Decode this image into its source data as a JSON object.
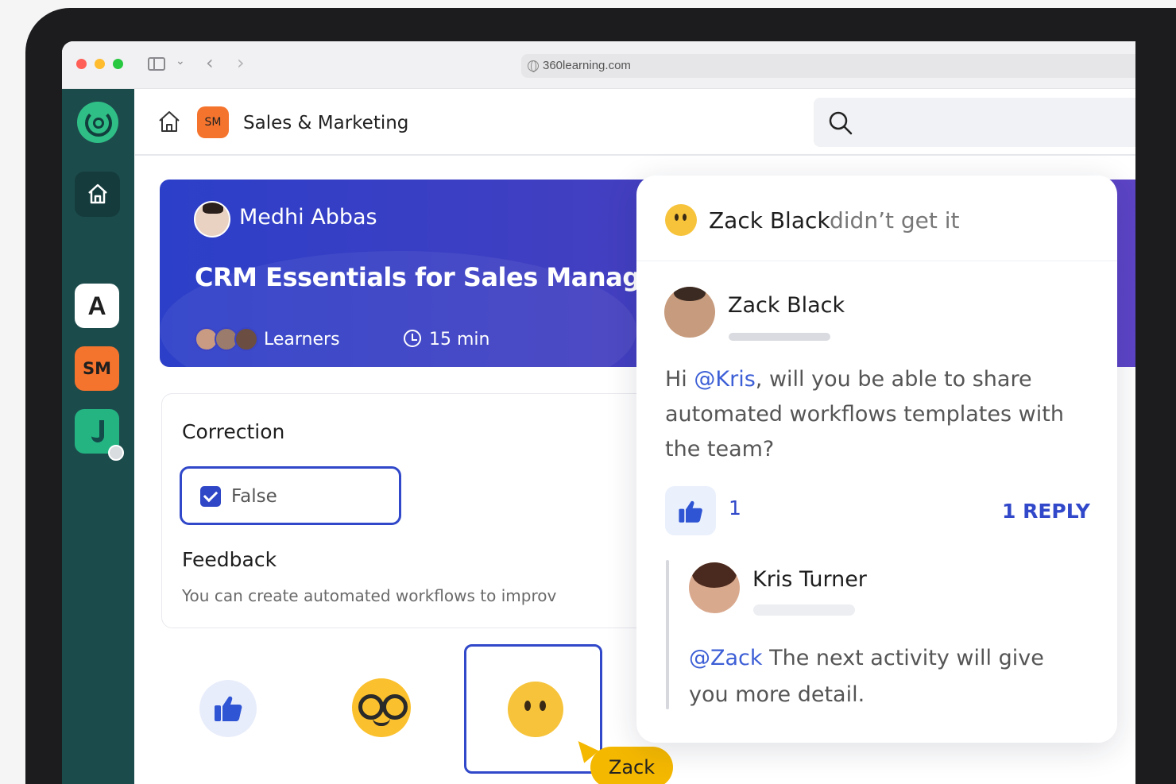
{
  "browser": {
    "url": "360learning.com"
  },
  "sidebar": {
    "apps": [
      {
        "label": "A"
      },
      {
        "label": "SM"
      }
    ]
  },
  "header": {
    "space_badge": "SM",
    "breadcrumb": "Sales & Marketing"
  },
  "course": {
    "author": "Medhi Abbas",
    "title": "CRM Essentials for Sales Manag",
    "learners_label": "Learners",
    "duration": "15 min"
  },
  "question": {
    "correction_title": "Correction",
    "answer": "False",
    "feedback_title": "Feedback",
    "feedback_text": "You can create automated workflows to improv"
  },
  "reactions": {
    "cursor_user": "Zack"
  },
  "comments": {
    "header_name": "Zack Black",
    "header_text": "didn’t get it",
    "main": {
      "author": "Zack Black",
      "greeting": "Hi",
      "mention": "@Kris",
      "text": " will you be able to share automated workflows templates with the team?",
      "likes": "1",
      "reply_link": "1 REPLY"
    },
    "reply": {
      "author": "Kris Turner",
      "mention": "@Zack",
      "text": " The next activity will give you more detail."
    }
  },
  "colors": {
    "accent": "#3048c9",
    "sidebar": "#1c4b4c",
    "space_orange": "#f5742d",
    "cursor": "#f5b800"
  }
}
